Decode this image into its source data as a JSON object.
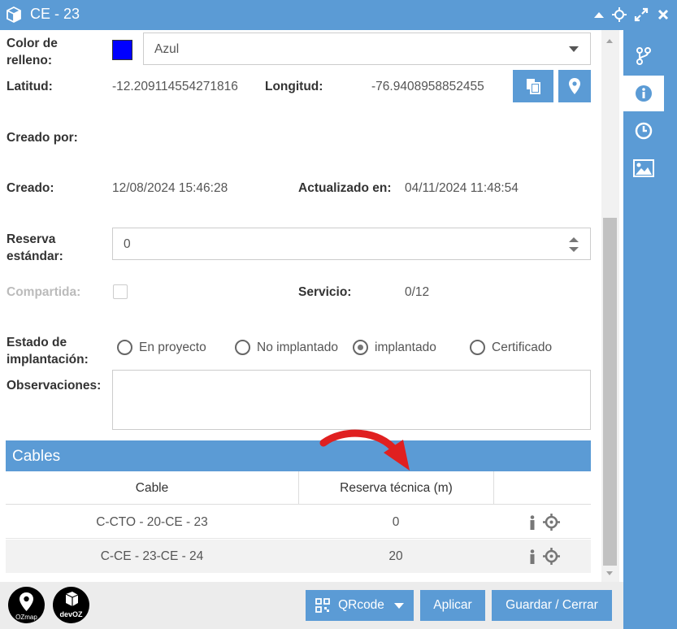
{
  "window": {
    "title": "CE - 23"
  },
  "form": {
    "color_label": "Color de relleno:",
    "color_value": "Azul",
    "color_hex": "#0000ff",
    "lat_label": "Latitud:",
    "lat_value": "-12.209114554271816",
    "lon_label": "Longitud:",
    "lon_value": "-76.9408958852455",
    "created_by_label": "Creado por:",
    "created_label": "Creado:",
    "created_value": "12/08/2024 15:46:28",
    "updated_label": "Actualizado en:",
    "updated_value": "04/11/2024 11:48:54",
    "reserve_label": "Reserva estándar:",
    "reserve_value": "0",
    "shared_label": "Compartida:",
    "service_label": "Servicio:",
    "service_value": "0/12",
    "state_label": "Estado de implantación:",
    "state_options": [
      "En proyecto",
      "No implantado",
      "implantado",
      "Certificado"
    ],
    "state_selected": "implantado",
    "notes_label": "Observaciones:"
  },
  "cables": {
    "header": "Cables",
    "columns": [
      "Cable",
      "Reserva técnica (m)"
    ],
    "rows": [
      {
        "cable": "C-CTO - 20-CE - 23",
        "reserve": "0"
      },
      {
        "cable": "C-CE - 23-CE - 24",
        "reserve": "20"
      }
    ]
  },
  "footer": {
    "logo1_text": "OZmap",
    "logo2_text": "devOZ",
    "qrcode_label": "QRcode",
    "apply_label": "Aplicar",
    "save_close_label": "Guardar / Cerrar"
  },
  "colors": {
    "accent": "#5b9bd5",
    "annotation_arrow": "#e02020"
  }
}
